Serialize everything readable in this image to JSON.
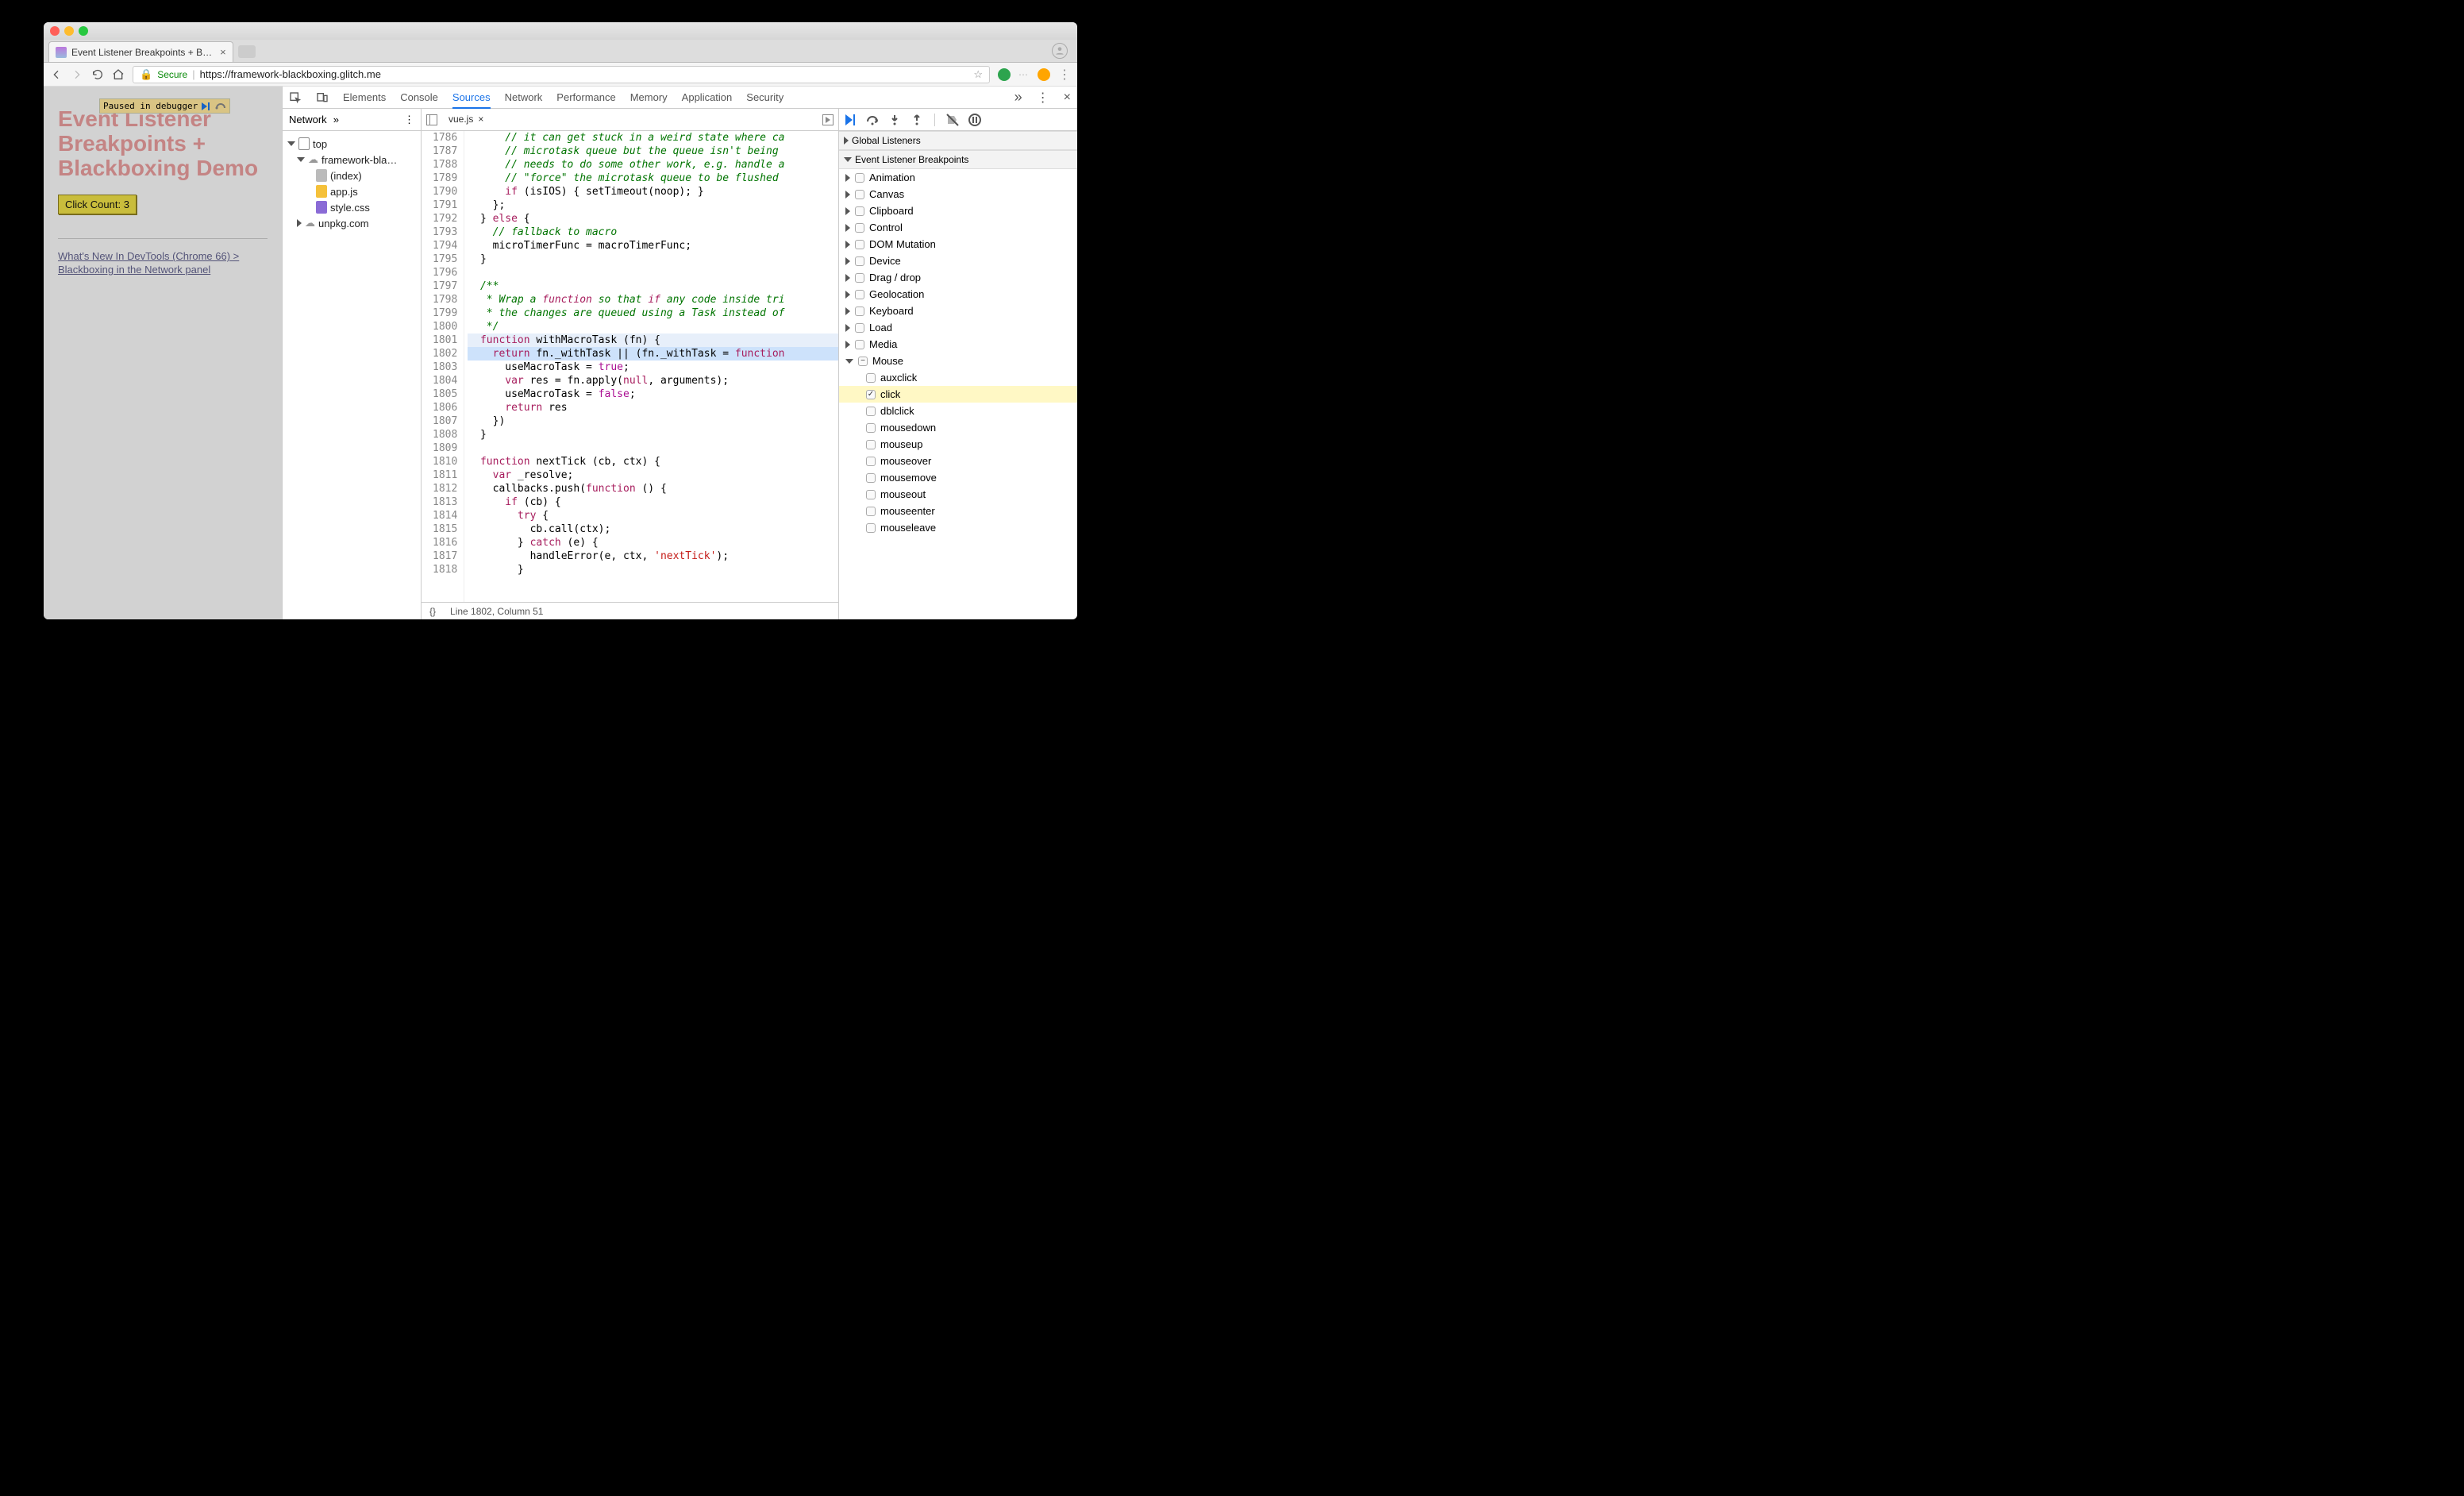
{
  "browser": {
    "tab_title": "Event Listener Breakpoints + B…",
    "url_secure": "Secure",
    "url_host": "https://framework-blackboxing.glitch.me"
  },
  "page": {
    "paused_text": "Paused in debugger",
    "heading": "Event Listener Breakpoints + Blackboxing Demo",
    "click_button": "Click Count: 3",
    "link_text": "What's New In DevTools (Chrome 66) > Blackboxing in the Network panel"
  },
  "devtools_tabs": [
    "Elements",
    "Console",
    "Sources",
    "Network",
    "Performance",
    "Memory",
    "Application",
    "Security"
  ],
  "devtools_active": "Sources",
  "left_panel": {
    "tab": "Network",
    "tree": {
      "top": "top",
      "domain": "framework-bla…",
      "files": [
        "(index)",
        "app.js",
        "style.css"
      ],
      "external": "unpkg.com"
    }
  },
  "source": {
    "filename": "vue.js",
    "first_line": 1786,
    "status": "Line 1802, Column 51",
    "prettyprint": "{}",
    "lines": [
      "      // it can get stuck in a weird state where ca",
      "      // microtask queue but the queue isn't being ",
      "      // needs to do some other work, e.g. handle a",
      "      // \"force\" the microtask queue to be flushed ",
      "      if (isIOS) { setTimeout(noop); }",
      "    };",
      "  } else {",
      "    // fallback to macro",
      "    microTimerFunc = macroTimerFunc;",
      "  }",
      "",
      "  /**",
      "   * Wrap a function so that if any code inside tri",
      "   * the changes are queued using a Task instead of",
      "   */",
      "  function withMacroTask (fn) {",
      "    return fn._withTask || (fn._withTask = function",
      "      useMacroTask = true;",
      "      var res = fn.apply(null, arguments);",
      "      useMacroTask = false;",
      "      return res",
      "    })",
      "  }",
      "",
      "  function nextTick (cb, ctx) {",
      "    var _resolve;",
      "    callbacks.push(function () {",
      "      if (cb) {",
      "        try {",
      "          cb.call(ctx);",
      "        } catch (e) {",
      "          handleError(e, ctx, 'nextTick');",
      "        }"
    ],
    "highlight_func_idx": 15,
    "highlight_exec_idx": 16
  },
  "right_panel": {
    "global_listeners": "Global Listeners",
    "elb_header": "Event Listener Breakpoints",
    "categories": [
      "Animation",
      "Canvas",
      "Clipboard",
      "Control",
      "DOM Mutation",
      "Device",
      "Drag / drop",
      "Geolocation",
      "Keyboard",
      "Load",
      "Media"
    ],
    "mouse": {
      "label": "Mouse",
      "expanded": true,
      "events": [
        "auxclick",
        "click",
        "dblclick",
        "mousedown",
        "mouseup",
        "mouseover",
        "mousemove",
        "mouseout",
        "mouseenter",
        "mouseleave"
      ],
      "checked": "click"
    }
  }
}
